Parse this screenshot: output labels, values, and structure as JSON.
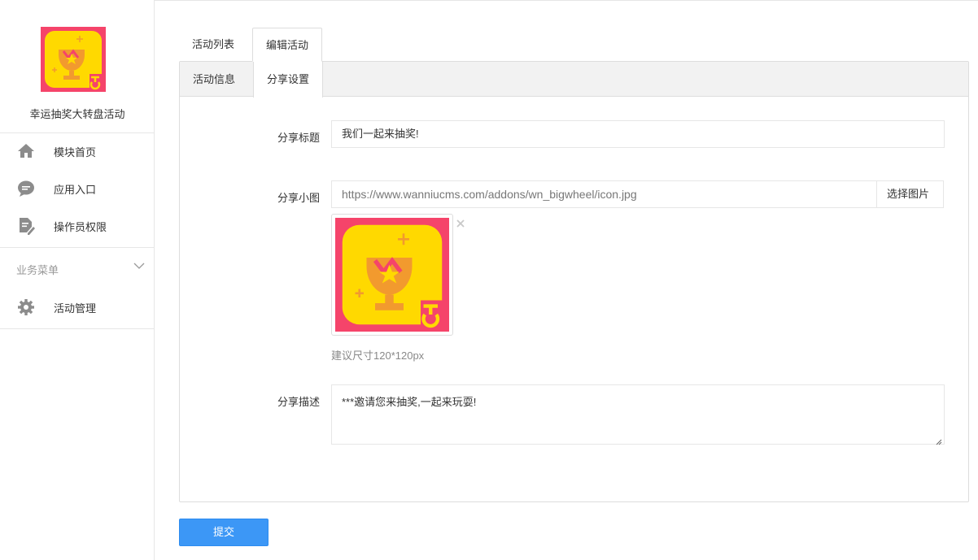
{
  "app": {
    "name": "幸运抽奖大转盘活动",
    "brand_colors": {
      "logo_bg": "#f5446a",
      "logo_fg": "#ffd900",
      "accent": "#3c97f6"
    }
  },
  "sidebar": {
    "items": [
      {
        "label": "模块首页",
        "icon": "home-icon"
      },
      {
        "label": "应用入口",
        "icon": "chat-bubble-icon"
      },
      {
        "label": "操作员权限",
        "icon": "edit-document-icon"
      }
    ],
    "group": {
      "title": "业务菜单",
      "items": [
        {
          "label": "活动管理",
          "icon": "gear-icon"
        }
      ]
    }
  },
  "tabs": [
    {
      "label": "活动列表",
      "active": false
    },
    {
      "label": "编辑活动",
      "active": true
    }
  ],
  "subtabs": [
    {
      "label": "活动信息",
      "active": false
    },
    {
      "label": "分享设置",
      "active": true
    }
  ],
  "form": {
    "share_title": {
      "label": "分享标题",
      "value": "我们一起来抽奖!"
    },
    "share_image": {
      "label": "分享小图",
      "value": "https://www.wanniucms.com/addons/wn_bigwheel/icon.jpg",
      "button": "选择图片",
      "remove_icon": "close-icon",
      "hint": "建议尺寸120*120px"
    },
    "share_desc": {
      "label": "分享描述",
      "value": "***邀请您来抽奖,一起来玩耍!"
    }
  },
  "submit_label": "提交"
}
